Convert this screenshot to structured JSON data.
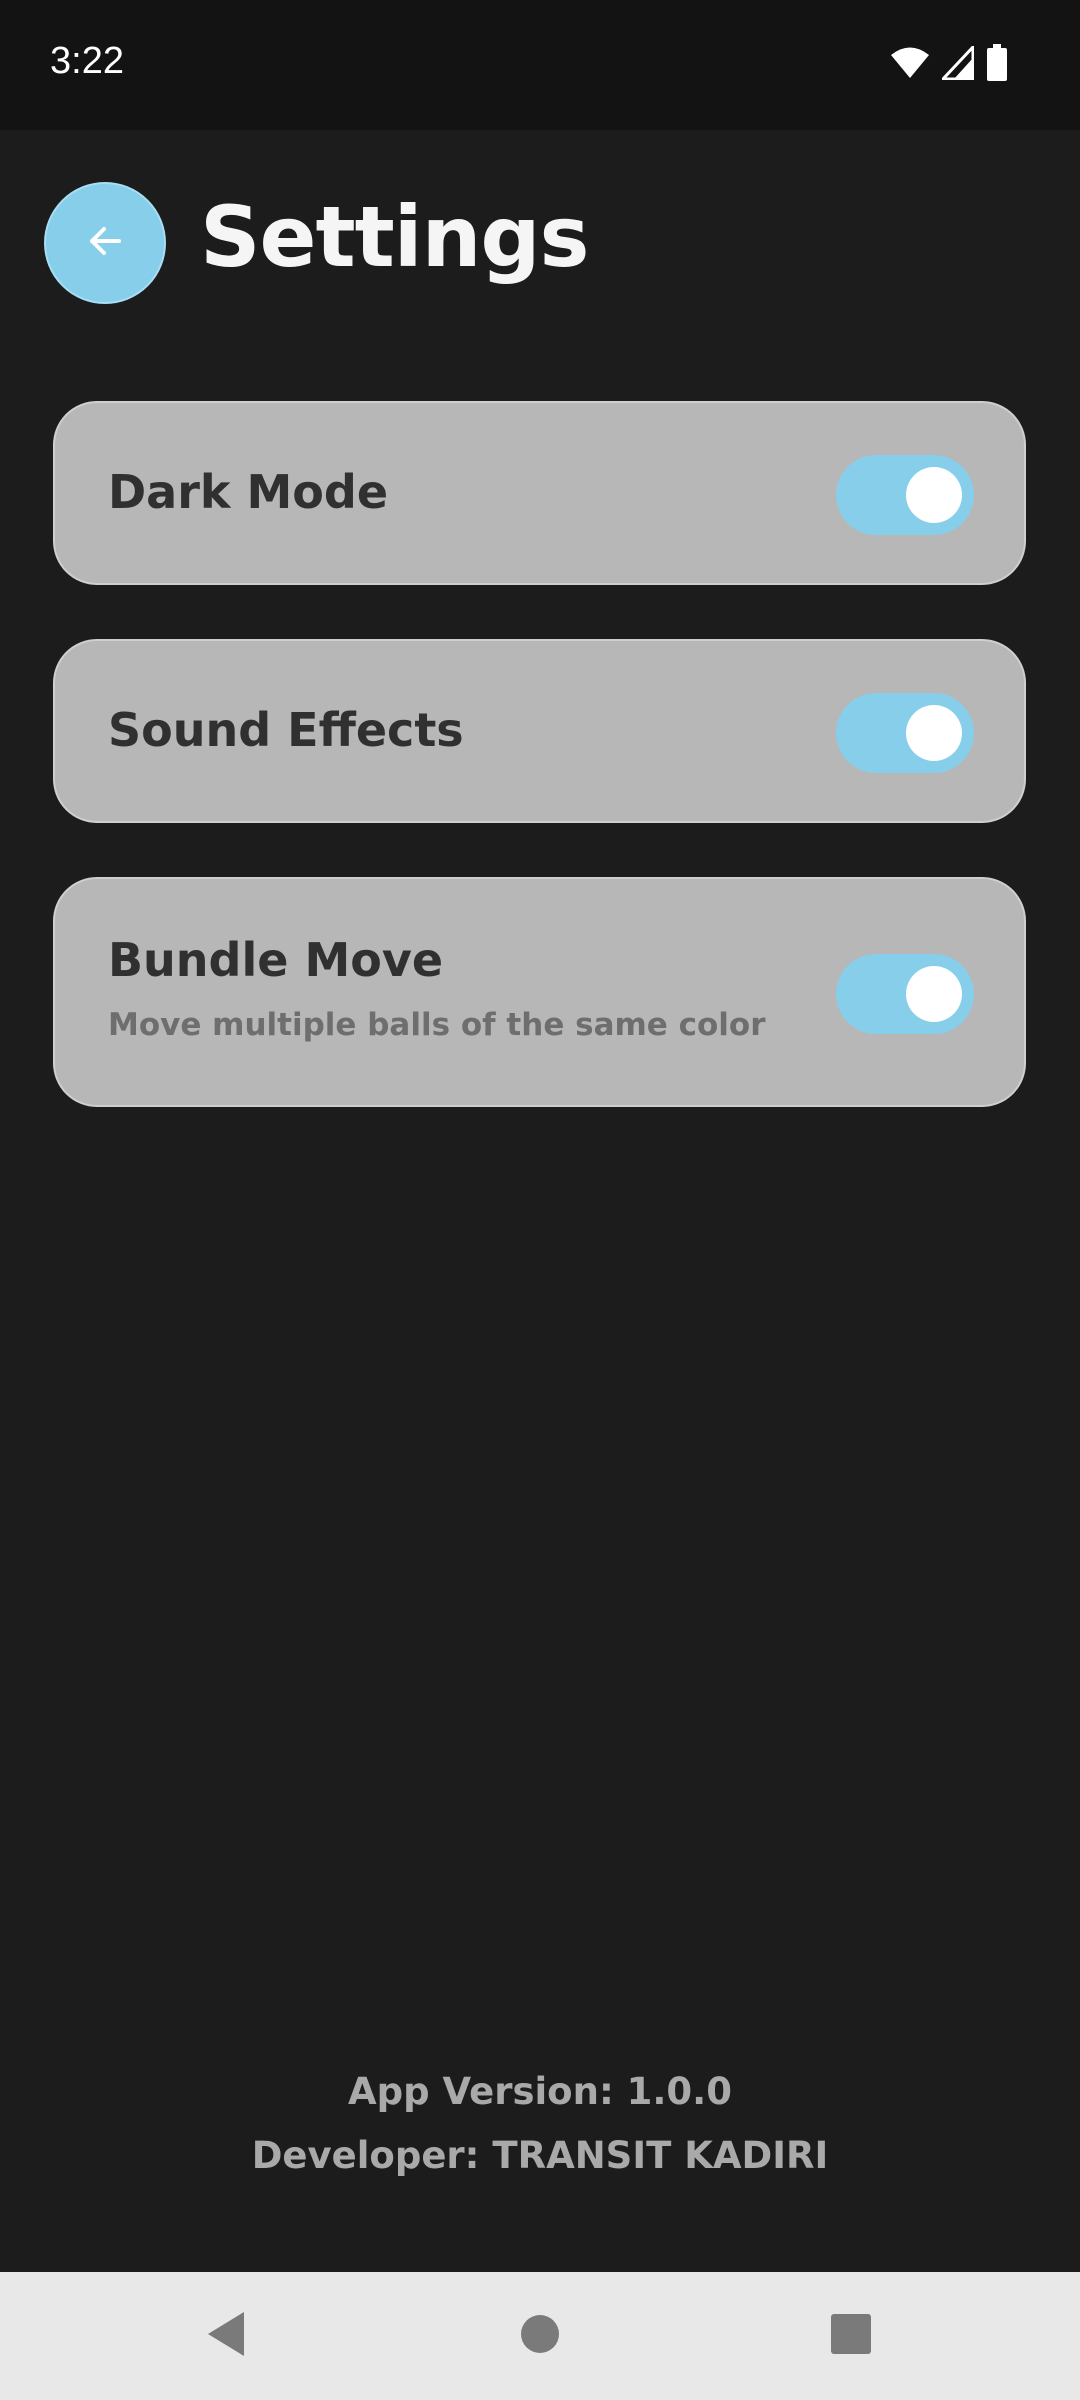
{
  "status_bar": {
    "time": "3:22",
    "icons": [
      "wifi-icon",
      "signal-icon",
      "battery-icon"
    ]
  },
  "header": {
    "back_icon": "arrow-left-icon",
    "title": "Settings"
  },
  "settings": [
    {
      "title": "Dark Mode",
      "subtitle": "",
      "enabled": true
    },
    {
      "title": "Sound Effects",
      "subtitle": "",
      "enabled": true
    },
    {
      "title": "Bundle Move",
      "subtitle": "Move multiple balls of the same color",
      "enabled": true
    }
  ],
  "footer": {
    "version": "App Version: 1.0.0",
    "developer": "Developer: TRANSIT KADIRI"
  },
  "nav_bar": {
    "icons": [
      "back-triangle-icon",
      "home-circle-icon",
      "recents-square-icon"
    ]
  },
  "colors": {
    "accent": "#87ceeb",
    "background": "#1c1c1c",
    "card": "#b7b7b7",
    "knob": "#ffffff"
  }
}
